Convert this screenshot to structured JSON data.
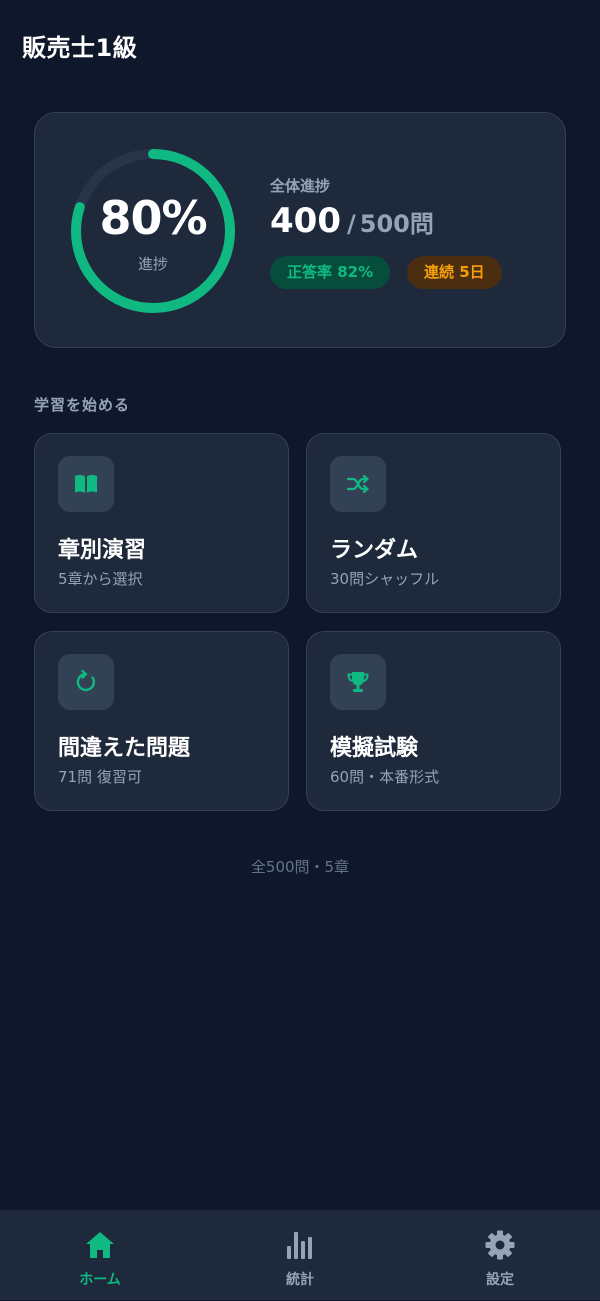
{
  "app": {
    "title": "販売士1級"
  },
  "progress": {
    "percent_text": "80%",
    "percent_value": 0.8,
    "ring_label": "進捗",
    "overall_label": "全体進捗",
    "done": "400",
    "separator": "/",
    "total": "500問",
    "accuracy_badge": "正答率 82%",
    "streak_badge": "連続 5日"
  },
  "section": {
    "title": "学習を始める"
  },
  "modes": [
    {
      "title": "章別演習",
      "subtitle": "5章から選択",
      "icon": "book-open-icon"
    },
    {
      "title": "ランダム",
      "subtitle": "30問シャッフル",
      "icon": "shuffle-icon"
    },
    {
      "title": "間違えた問題",
      "subtitle": "71問 復習可",
      "icon": "refresh-icon"
    },
    {
      "title": "模擬試験",
      "subtitle": "60問・本番形式",
      "icon": "trophy-icon"
    }
  ],
  "footer": {
    "note": "全500問・5章"
  },
  "nav": {
    "items": [
      {
        "label": "ホーム",
        "icon": "home-icon",
        "active": true
      },
      {
        "label": "統計",
        "icon": "bar-chart-icon",
        "active": false
      },
      {
        "label": "設定",
        "icon": "gear-icon",
        "active": false
      }
    ]
  },
  "colors": {
    "background": "#0f172a",
    "card": "#1e293b",
    "accent": "#10b981",
    "warning": "#f59e0b",
    "muted": "#94a3b8"
  }
}
